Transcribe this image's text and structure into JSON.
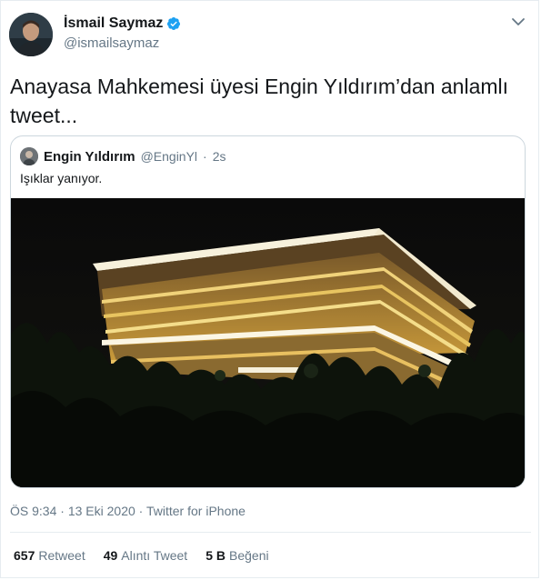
{
  "author": {
    "name": "İsmail Saymaz",
    "handle": "@ismailsaymaz"
  },
  "tweet": {
    "text": "Anayasa Mahkemesi üyesi Engin Yıldırım’dan anlamlı tweet..."
  },
  "quoted": {
    "name": "Engin Yıldırım",
    "handle": "@EnginYl",
    "separator": "·",
    "time": "2s",
    "text": "Işıklar yanıyor."
  },
  "meta": {
    "time": "ÖS 9:34",
    "sep1": "·",
    "date": "13 Eki 2020",
    "sep2": "·",
    "source": "Twitter for iPhone"
  },
  "stats": {
    "retweets": "657",
    "retweets_label": "Retweet",
    "quotes": "49",
    "quotes_label": "Alıntı Tweet",
    "likes": "5 B",
    "likes_label": "Beğeni"
  },
  "icons": {
    "verified": "verified-badge-icon",
    "caret": "chevron-down-icon"
  },
  "colors": {
    "text": "#14171a",
    "muted": "#657786",
    "verified": "#1da1f2",
    "border": "#ccd6dd"
  }
}
